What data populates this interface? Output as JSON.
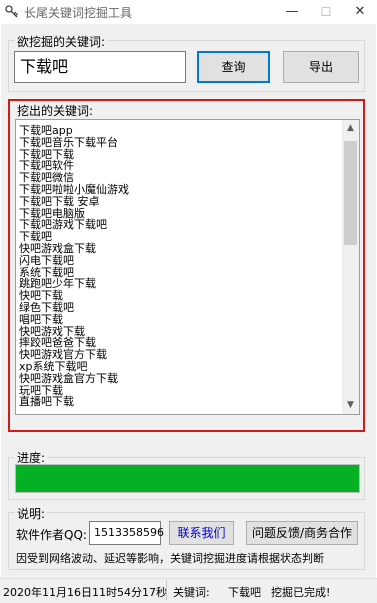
{
  "window": {
    "title": "长尾关键词挖掘工具",
    "minimize": "—",
    "maximize": "☐",
    "close": "✕"
  },
  "keyword_group": {
    "label": "欲挖掘的关键词:",
    "input_value": "下载吧",
    "query_button": "查询",
    "export_button": "导出"
  },
  "results": {
    "label": "挖出的关键词:",
    "items": [
      "下载吧app",
      "下载吧音乐下载平台",
      "下载吧下载",
      "下载吧软件",
      "下载吧微信",
      "下载吧啦啦小魔仙游戏",
      "下载吧下载 安卓",
      "下载吧电脑版",
      "下载吧游戏下载吧",
      "下载吧",
      "快吧游戏盒下载",
      "闪电下载吧",
      "系统下载吧",
      "跳跑吧少年下载",
      "快吧下载",
      "绿色下载吧",
      "唱吧下载",
      "快吧游戏下载",
      "摔跤吧爸爸下载",
      "快吧游戏官方下载",
      "xp系统下载吧",
      "快吧游戏盒官方下载",
      "玩吧下载",
      "直播吧下载"
    ]
  },
  "progress": {
    "label": "进度:",
    "value": 1.0
  },
  "info": {
    "label": "说明:",
    "author_qq_label": "软件作者QQ:",
    "author_qq_value": "1513358596",
    "contact_button": "联系我们",
    "feedback_button": "问题反馈/商务合作",
    "notice": "因受到网络波动、延迟等影响，关键词挖掘进度请根据状态判断"
  },
  "status": {
    "datetime": "2020年11月16日11时54分17秒",
    "keyword_label": "关键词:",
    "keyword_value": "下载吧",
    "state": "挖掘已完成!"
  },
  "colors": {
    "accent_red": "#d11a1a",
    "progress_green": "#06b025",
    "link_blue": "#0000cc"
  }
}
